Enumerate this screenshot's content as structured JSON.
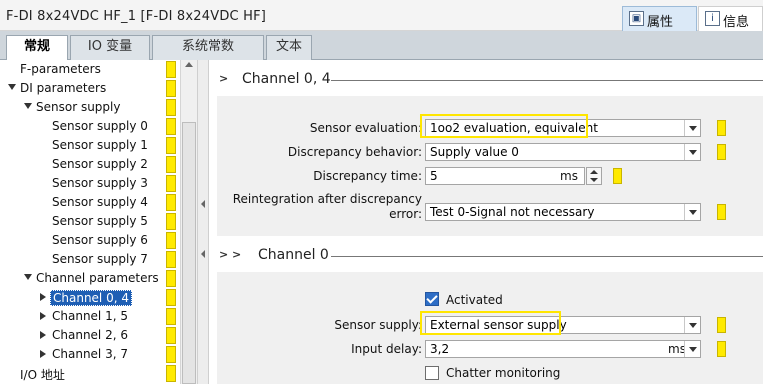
{
  "window": {
    "title": "F-DI 8x24VDC HF_1 [F-DI 8x24VDC HF]"
  },
  "right_tabs": [
    {
      "label": "属性",
      "icon": "properties-icon"
    },
    {
      "label": "信息",
      "icon": "info-icon"
    }
  ],
  "tabs": [
    {
      "label": "常规",
      "selected": true
    },
    {
      "label": "IO 变量",
      "selected": false
    },
    {
      "label": "系统常数",
      "selected": false
    },
    {
      "label": "文本",
      "selected": false
    }
  ],
  "nav": {
    "items": [
      {
        "label": "F-parameters"
      },
      {
        "label": "DI parameters"
      },
      {
        "label": "Sensor supply"
      },
      {
        "label": "Sensor supply 0"
      },
      {
        "label": "Sensor supply 1"
      },
      {
        "label": "Sensor supply 2"
      },
      {
        "label": "Sensor supply 3"
      },
      {
        "label": "Sensor supply 4"
      },
      {
        "label": "Sensor supply 5"
      },
      {
        "label": "Sensor supply 6"
      },
      {
        "label": "Sensor supply 7"
      },
      {
        "label": "Channel parameters"
      },
      {
        "label": "Channel 0, 4"
      },
      {
        "label": "Channel 1, 5"
      },
      {
        "label": "Channel 2, 6"
      },
      {
        "label": "Channel 3, 7"
      },
      {
        "label": "I/O 地址"
      }
    ]
  },
  "section1": {
    "chevron": ">",
    "title": "Channel 0, 4",
    "sensor_evaluation": {
      "label": "Sensor evaluation:",
      "value": "1oo2 evaluation, equivalent"
    },
    "discrepancy_behavior": {
      "label": "Discrepancy behavior:",
      "value": "Supply value 0"
    },
    "discrepancy_time": {
      "label": "Discrepancy time:",
      "value": "5",
      "unit": "ms"
    },
    "reintegration": {
      "label_line1": "Reintegration after discrepancy",
      "label_line2": "error:",
      "value": "Test 0-Signal not necessary"
    }
  },
  "section2": {
    "chevron": "> >",
    "title": "Channel 0",
    "activated": {
      "label": "Activated",
      "checked": true
    },
    "sensor_supply": {
      "label": "Sensor supply:",
      "value": "External sensor supply"
    },
    "input_delay": {
      "label": "Input delay:",
      "value": "3,2",
      "unit": "ms"
    },
    "chatter_monitoring": {
      "label": "Chatter monitoring",
      "checked": false
    }
  },
  "colors": {
    "highlight": "#ffe600",
    "selection": "#1f5fb4",
    "panel": "#f0f0f0"
  }
}
